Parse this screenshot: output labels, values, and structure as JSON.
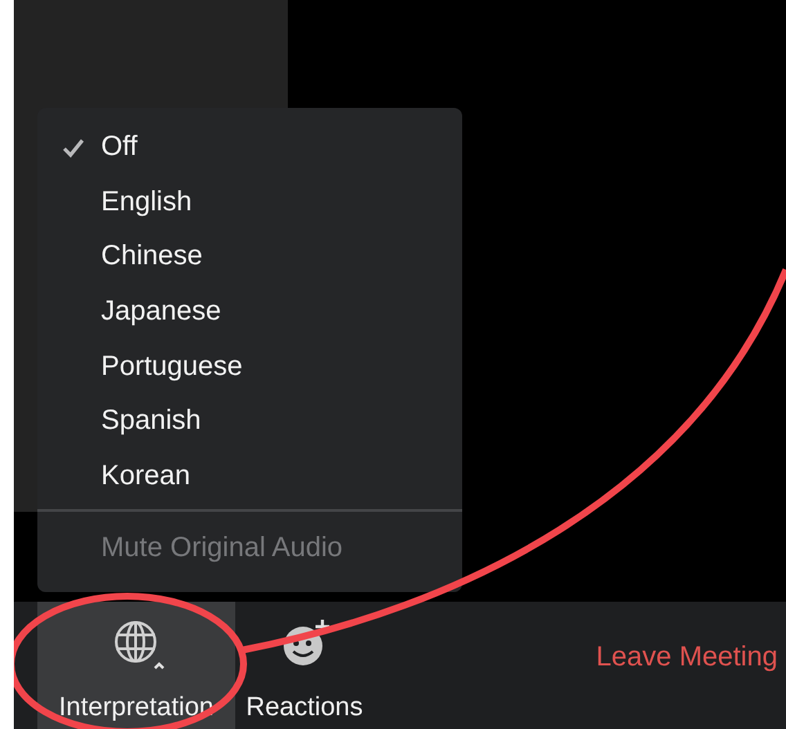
{
  "interpretation_menu": {
    "items": [
      {
        "label": "Off",
        "selected": true
      },
      {
        "label": "English",
        "selected": false
      },
      {
        "label": "Chinese",
        "selected": false
      },
      {
        "label": "Japanese",
        "selected": false
      },
      {
        "label": "Portuguese",
        "selected": false
      },
      {
        "label": "Spanish",
        "selected": false
      },
      {
        "label": "Korean",
        "selected": false
      }
    ],
    "footer_item": {
      "label": "Mute Original Audio",
      "disabled": true
    }
  },
  "toolbar": {
    "buttons": [
      {
        "kind": "globe",
        "label": "Interpretation",
        "selected": true
      },
      {
        "kind": "reactions",
        "label": "Reactions",
        "selected": false
      }
    ],
    "leave": "Leave Meeting"
  }
}
